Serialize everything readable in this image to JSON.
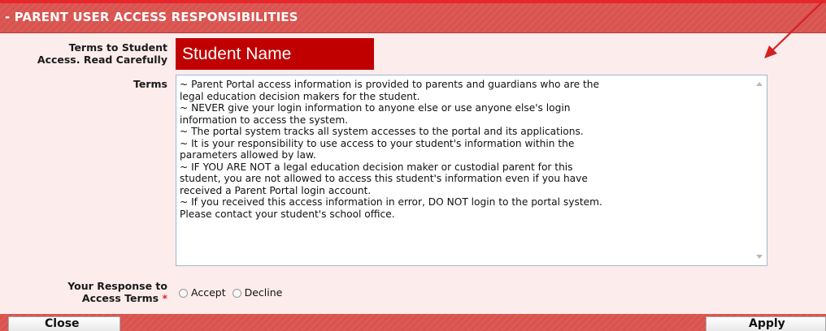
{
  "header": {
    "title": "- PARENT USER ACCESS RESPONSIBILITIES"
  },
  "labels": {
    "terms_to_student_line1": "Terms to Student",
    "terms_to_student_line2": "Access. Read Carefully",
    "terms": "Terms",
    "response_line1": "Your Response to",
    "response_line2": "Access Terms",
    "required_marker": "*"
  },
  "student": {
    "name": "Student Name",
    "highlight_color": "#c00000"
  },
  "terms_lines": [
    "~ Parent Portal access information is provided to parents and guardians who are the",
    "legal education decision makers for the student.",
    "~ NEVER give your login information to anyone else or use anyone else's login",
    "information to access the system.",
    "~ The portal system tracks all system accesses to the portal and its applications.",
    "~ It is your responsibility to use access to your student's information within the",
    "parameters allowed by law.",
    "~ IF YOU ARE NOT a legal education decision maker or custodial parent for this",
    "student, you are not allowed to access this student's information even if you have",
    "received a Parent Portal login account.",
    "~ If you received this access information in error, DO NOT login to the portal system.",
    "Please contact your student's school office."
  ],
  "response_options": [
    {
      "label": "Accept",
      "selected": false
    },
    {
      "label": "Decline",
      "selected": false
    }
  ],
  "buttons": {
    "close": "Close",
    "apply": "Apply"
  },
  "colors": {
    "header_bg": "#d9534f",
    "page_bg": "#fdecec",
    "accent_red": "#e8262b"
  },
  "icons": {
    "annotation": "red-arrow-icon"
  }
}
